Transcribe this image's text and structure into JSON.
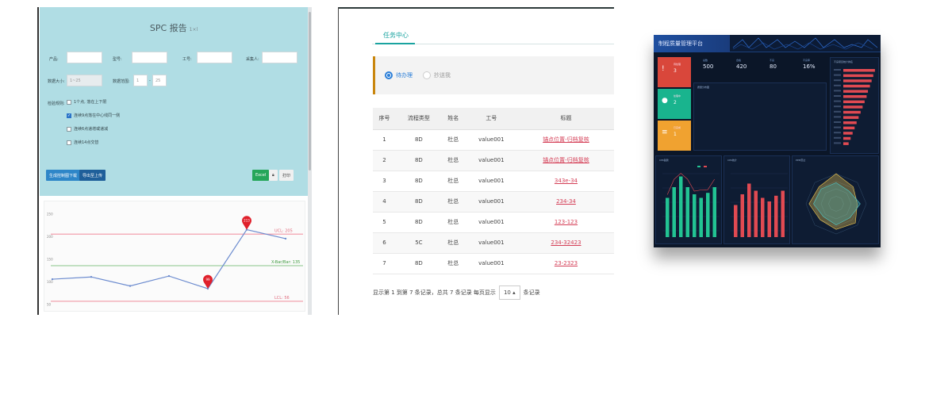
{
  "spc": {
    "title": "SPC 报告",
    "subtitle": "1×l",
    "labels": {
      "product": "产品:",
      "model": "型号:",
      "process": "工号:",
      "inspector": "采集人:"
    },
    "fields": {
      "batch_label": "数据大小:",
      "batch_value": "1~25",
      "range_label": "数据范围:",
      "range_from": "1",
      "range_to": "25"
    },
    "rules_label": "检验规则:",
    "rules": [
      {
        "label": "1个点, 落在上下限",
        "checked": false
      },
      {
        "label": "连续9点落在中心线同一侧",
        "checked": true
      },
      {
        "label": "连续6点递增或递减",
        "checked": false
      },
      {
        "label": "连续14点交替",
        "checked": false
      }
    ],
    "buttons": {
      "gen_report": "生成控制图下载",
      "upload": "导出至上传",
      "green": "Excel",
      "print": "打印"
    },
    "chart": {
      "ucl_label": "UCL: 205",
      "mean_label": "X-Bar/Bar: 135",
      "lcl_label": "LCL: 56",
      "marker_a": "99",
      "marker_b": "213",
      "ytick_a": "250",
      "ytick_b": "200",
      "ytick_c": "150",
      "ytick_d": "100",
      "ytick_e": "50",
      "series": [
        {
          "x": 1,
          "y": 105
        },
        {
          "x": 2,
          "y": 110
        },
        {
          "x": 3,
          "y": 90
        },
        {
          "x": 4,
          "y": 112
        },
        {
          "x": 5,
          "y": 84
        },
        {
          "x": 6,
          "y": 215
        },
        {
          "x": 7,
          "y": 195
        }
      ]
    },
    "colors": {
      "bg": "#b0dde4",
      "limit": "#f2a1ae",
      "center": "#8ac48a",
      "line": "#6d8ccf",
      "marker": "#e0202b"
    }
  },
  "tasks": {
    "tab": "任务中心",
    "radio_pending": "待办理",
    "radio_cc": "抄送我",
    "columns": [
      "序号",
      "流程类型",
      "姓名",
      "工号",
      "标题"
    ],
    "rows": [
      [
        "1",
        "8D",
        "杜总",
        "value001",
        "锚点位置-归档复核"
      ],
      [
        "2",
        "8D",
        "杜总",
        "value001",
        "锚点位置-归档复核"
      ],
      [
        "3",
        "8D",
        "杜总",
        "value001",
        "343e-34"
      ],
      [
        "4",
        "8D",
        "杜总",
        "value001",
        "234-34"
      ],
      [
        "5",
        "8D",
        "杜总",
        "value001",
        "123-123"
      ],
      [
        "6",
        "5C",
        "杜总",
        "value001",
        "234-32423"
      ],
      [
        "7",
        "8D",
        "杜总",
        "value001",
        "23-2323"
      ]
    ],
    "pager_prefix": "显示第 1 到第 7 条记录，总共 7 条记录 每页显示",
    "page_size": "10 ▴",
    "pager_suffix": "条记录"
  },
  "dashboard": {
    "title": "制程质量管理平台",
    "tiles": [
      {
        "icon": "!",
        "cap": "待处理",
        "num": "3",
        "color": "#d9473b"
      },
      {
        "icon": "●",
        "cap": "处理中",
        "num": "2",
        "color": "#19b48e"
      },
      {
        "icon": "≡",
        "cap": "已完成",
        "num": "1",
        "color": "#f0a230"
      }
    ],
    "kpis": [
      {
        "k": "总数",
        "v": "500"
      },
      {
        "k": "合格",
        "v": "420"
      },
      {
        "k": "不良",
        "v": "80"
      },
      {
        "k": "不良率",
        "v": "16%"
      }
    ],
    "panels": {
      "dist": "质量分布图",
      "rank": "不良项目统计排名",
      "c1": "CPK趋势",
      "c2": "CPK统计",
      "c3": "PPM雷达"
    },
    "rank_values": [
      95,
      90,
      85,
      80,
      74,
      70,
      64,
      58,
      52,
      46,
      40,
      34,
      28,
      22,
      16
    ],
    "bars_a": [
      55,
      70,
      85,
      70,
      60,
      55,
      62,
      70
    ],
    "bars_b": [
      45,
      60,
      75,
      65,
      55,
      50,
      58,
      65
    ],
    "colors": {
      "bg": "#0b1628",
      "green": "#22c393",
      "red": "#e14a52",
      "accent": "#e14a52"
    }
  }
}
